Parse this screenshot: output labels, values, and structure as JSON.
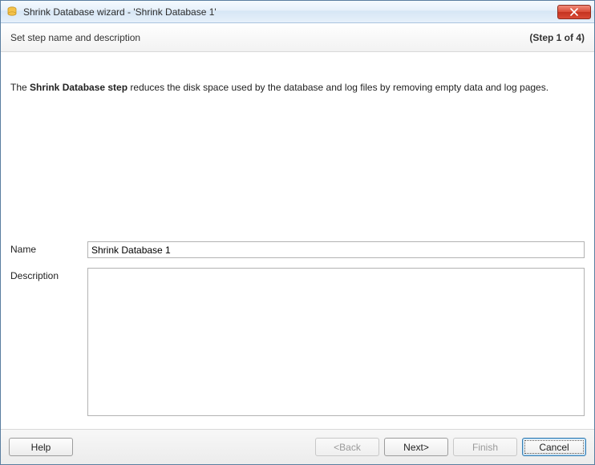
{
  "window": {
    "title": "Shrink Database wizard - 'Shrink Database 1'"
  },
  "subheader": {
    "left": "Set step name and description",
    "right": "(Step 1 of 4)"
  },
  "intro": {
    "prefix": "The ",
    "bold": "Shrink Database step",
    "suffix": " reduces the disk space used by the database and log files by removing empty data and log pages."
  },
  "form": {
    "name_label": "Name",
    "name_value": "Shrink Database 1",
    "description_label": "Description",
    "description_value": ""
  },
  "footer": {
    "help": "Help",
    "back": "<Back",
    "next": "Next>",
    "finish": "Finish",
    "cancel": "Cancel"
  }
}
